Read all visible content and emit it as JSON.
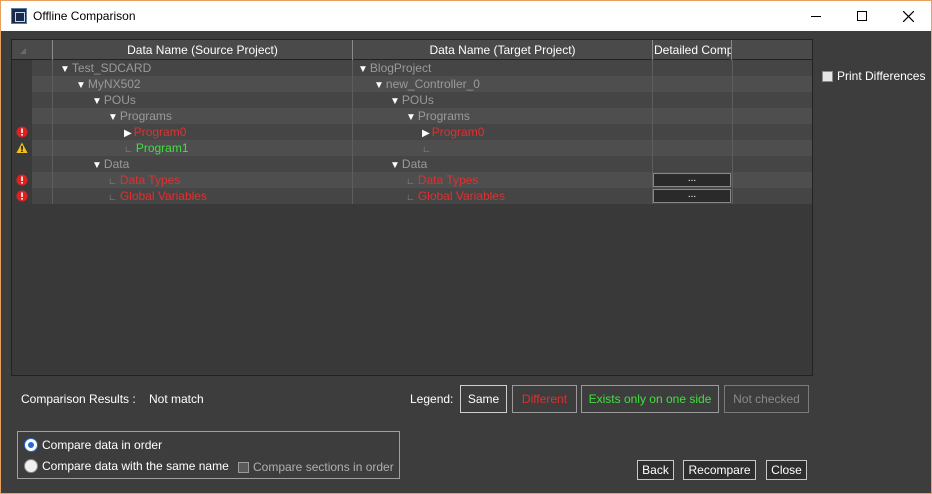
{
  "window": {
    "title": "Offline Comparison"
  },
  "grid": {
    "columns": {
      "source": "Data Name (Source Project)",
      "target": "Data Name (Target Project)",
      "detail": "Detailed Comp"
    },
    "rows": [
      {
        "status": "",
        "source": "Test_SDCARD",
        "source_color": "gray",
        "source_indent": 0,
        "source_expander": "down",
        "target": "BlogProject",
        "target_color": "gray",
        "target_indent": 0,
        "target_expander": "down",
        "detail_button": ""
      },
      {
        "status": "",
        "source": "MyNX502",
        "source_color": "gray",
        "source_indent": 1,
        "source_expander": "down",
        "target": "new_Controller_0",
        "target_color": "gray",
        "target_indent": 1,
        "target_expander": "down",
        "detail_button": ""
      },
      {
        "status": "",
        "source": "POUs",
        "source_color": "gray",
        "source_indent": 2,
        "source_expander": "down",
        "target": "POUs",
        "target_color": "gray",
        "target_indent": 2,
        "target_expander": "down",
        "detail_button": ""
      },
      {
        "status": "",
        "source": "Programs",
        "source_color": "gray",
        "source_indent": 3,
        "source_expander": "down",
        "target": "Programs",
        "target_color": "gray",
        "target_indent": 3,
        "target_expander": "down",
        "detail_button": ""
      },
      {
        "status": "error",
        "source": "Program0",
        "source_color": "red",
        "source_indent": 4,
        "source_expander": "right",
        "target": "Program0",
        "target_color": "red",
        "target_indent": 4,
        "target_expander": "right",
        "detail_button": ""
      },
      {
        "status": "warning",
        "source": "Program1",
        "source_color": "green",
        "source_indent": 4,
        "source_expander": "leaf",
        "target": "",
        "target_color": "gray",
        "target_indent": 4,
        "target_expander": "leaf",
        "detail_button": ""
      },
      {
        "status": "",
        "source": "Data",
        "source_color": "gray",
        "source_indent": 2,
        "source_expander": "down",
        "target": "Data",
        "target_color": "gray",
        "target_indent": 2,
        "target_expander": "down",
        "detail_button": ""
      },
      {
        "status": "error",
        "source": "Data Types",
        "source_color": "red",
        "source_indent": 3,
        "source_expander": "leaf",
        "target": "Data Types",
        "target_color": "red",
        "target_indent": 3,
        "target_expander": "leaf",
        "detail_button": "..."
      },
      {
        "status": "error",
        "source": "Global Variables",
        "source_color": "red",
        "source_indent": 3,
        "source_expander": "leaf",
        "target": "Global Variables",
        "target_color": "red",
        "target_indent": 3,
        "target_expander": "leaf",
        "detail_button": "..."
      }
    ]
  },
  "print_differences": {
    "label": "Print Differences",
    "checked": false
  },
  "results": {
    "label": "Comparison Results :",
    "value": "Not match"
  },
  "legend": {
    "label": "Legend:",
    "same": "Same",
    "different": "Different",
    "one_side": "Exists only on one side",
    "not_checked": "Not checked"
  },
  "compare_options": {
    "in_order": "Compare data in order",
    "same_name": "Compare data with the same name",
    "sections_in_order": "Compare sections in order",
    "selected": "in_order"
  },
  "buttons": {
    "back": "Back",
    "recompare": "Recompare",
    "close": "Close"
  },
  "colors": {
    "different": "#e03030",
    "one_side": "#40e040",
    "error_icon": "#e02020",
    "warning_icon": "#f0c020"
  }
}
